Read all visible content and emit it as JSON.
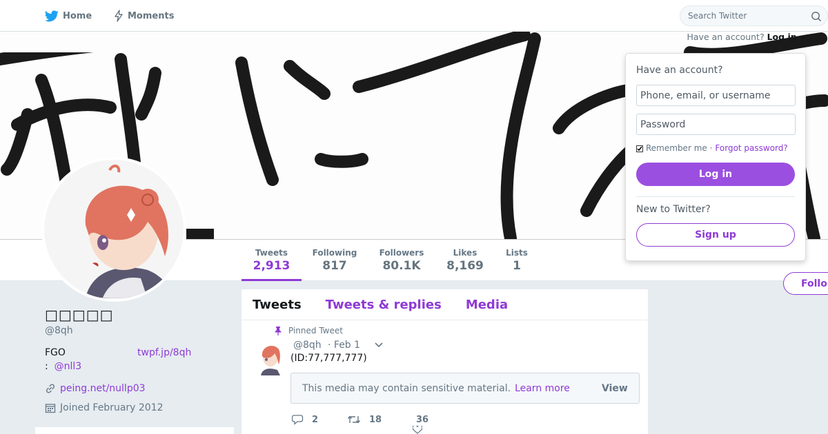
{
  "nav": {
    "home_label": "Home",
    "moments_label": "Moments",
    "search_placeholder": "Search Twitter",
    "have_account_text": "Have an account?",
    "login_label": "Log in"
  },
  "profile": {
    "name": "□□□□□",
    "handle": "@8qh",
    "bio_line1": "FGO",
    "bio_link": "twpf.jp/8qh",
    "bio_line2_prefix": ":",
    "bio_mention": "@nll3",
    "url": "peing.net/nullp03",
    "joined": "Joined February 2012",
    "follow_label": "Follo"
  },
  "stats": [
    {
      "label": "Tweets",
      "value": "2,913"
    },
    {
      "label": "Following",
      "value": "817"
    },
    {
      "label": "Followers",
      "value": "80.1K"
    },
    {
      "label": "Likes",
      "value": "8,169"
    },
    {
      "label": "Lists",
      "value": "1"
    }
  ],
  "timeline": {
    "tabs": [
      "Tweets",
      "Tweets & replies",
      "Media"
    ],
    "pinned_label": "Pinned Tweet",
    "tweet": {
      "handle": "@8qh",
      "date": "· Feb 1",
      "text": "(ID:77,777,777)",
      "sensitive_text": "This media may contain sensitive material.",
      "learn_more": "Learn more",
      "view_label": "View",
      "replies": "2",
      "retweets": "18",
      "likes": "36"
    }
  },
  "login_dropdown": {
    "title": "Have an account?",
    "username_placeholder": "Phone, email, or username",
    "password_placeholder": "Password",
    "remember_label": "Remember me ·",
    "forgot_label": "Forgot password?",
    "login_button": "Log in",
    "new_text": "New to Twitter?",
    "signup_button": "Sign up"
  },
  "colors": {
    "accent": "#8e3ad6",
    "twitter_blue": "#1da1f2",
    "background": "#e6ecf0"
  }
}
